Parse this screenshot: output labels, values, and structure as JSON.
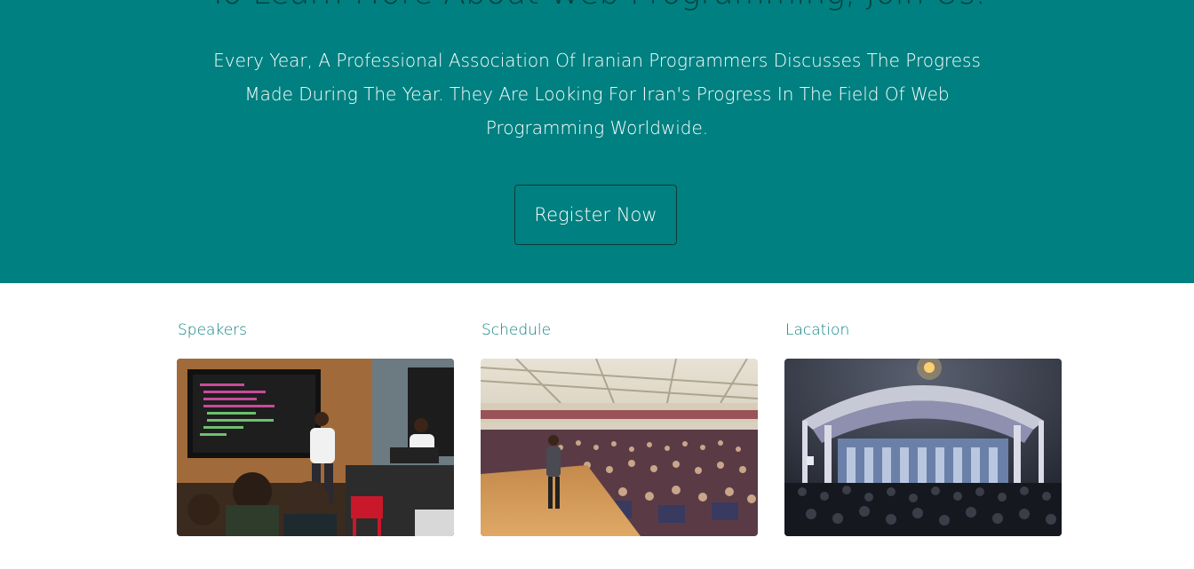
{
  "hero": {
    "title": "To Learn More About Web Programming, Join Us.",
    "description": "Every Year, A Professional Association Of Iranian Programmers Discusses The Progress Made During The Year. They Are Looking For Iran's Progress In The Field Of Web Programming Worldwide.",
    "register_label": "Register Now",
    "background_color": "#008080"
  },
  "cards": [
    {
      "title": "Speakers",
      "image_icon": "speakers-photo"
    },
    {
      "title": "Schedule",
      "image_icon": "schedule-photo"
    },
    {
      "title": "Lacation",
      "image_icon": "location-photo"
    }
  ]
}
